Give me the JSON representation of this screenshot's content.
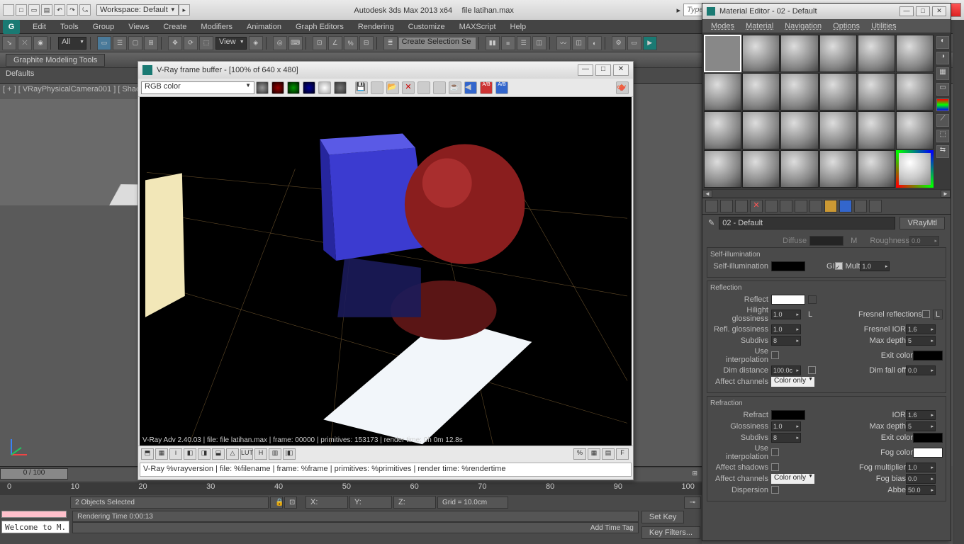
{
  "title": {
    "app": "Autodesk 3ds Max  2013 x64",
    "file": "file latihan.max",
    "workspace": "Workspace: Default",
    "search_ph": "Type a keyword or phrase"
  },
  "menu": [
    "Edit",
    "Tools",
    "Group",
    "Views",
    "Create",
    "Modifiers",
    "Animation",
    "Graph Editors",
    "Rendering",
    "Customize",
    "MAXScript",
    "Help"
  ],
  "toolbar": {
    "all": "All",
    "view": "View",
    "namedsel": "Create Selection Se"
  },
  "graphite": {
    "tab": "Graphite Modeling Tools",
    "defaults": "Defaults"
  },
  "viewport": {
    "label": "[ + ] [ VRayPhysicalCamera001 ] [ Shad"
  },
  "vfb": {
    "title": "V-Ray frame buffer - [100% of 640 x 480]",
    "channel": "RGB color",
    "status1": "V-Ray Adv 2.40.03 | file: file latihan.max | frame: 00000 | primitives: 153173 | render time:  0h  0m 12.8s",
    "btns": [
      "⬒",
      "▦",
      "i",
      "◧",
      "◨",
      "⬓",
      "△",
      "LUT",
      "H",
      "▥",
      "|◧"
    ],
    "status2": "V-Ray %vrayversion | file: %filename | frame: %frame | primitives: %primitives | render time: %rendertime"
  },
  "medit": {
    "title": "Material Editor - 02 - Default",
    "menu": [
      "Modes",
      "Material",
      "Navigation",
      "Options",
      "Utilities"
    ],
    "current": "02 - Default",
    "type": "VRayMtl",
    "scroll_arrows": [
      "◄",
      "►"
    ],
    "groups": {
      "selfillum": {
        "title": "Self-illumination",
        "label": "Self-illumination",
        "gi": "GI",
        "mult": "Mult",
        "multv": "1.0"
      },
      "reflection": {
        "title": "Reflection",
        "labels": {
          "reflect": "Reflect",
          "hilight": "Hilight glossiness",
          "refl": "Refl. glossiness",
          "subdivs": "Subdivs",
          "interp": "Use interpolation",
          "dim": "Dim distance",
          "affect": "Affect channels",
          "fresnel": "Fresnel reflections",
          "ior": "Fresnel IOR",
          "maxd": "Max depth",
          "exit": "Exit color",
          "falloff": "Dim fall off"
        },
        "vals": {
          "hilight": "1.0",
          "refl": "1.0",
          "subdivs": "8",
          "dim": "100.0c",
          "ior": "1.6",
          "maxd": "5",
          "falloff": "0.0",
          "affect": "Color only"
        }
      },
      "refraction": {
        "title": "Refraction",
        "labels": {
          "refract": "Refract",
          "gloss": "Glossiness",
          "subdivs": "Subdivs",
          "interp": "Use interpolation",
          "shadows": "Affect shadows",
          "affect": "Affect channels",
          "ior": "IOR",
          "maxd": "Max depth",
          "exit": "Exit color",
          "fogc": "Fog color",
          "fogm": "Fog multiplier",
          "fogb": "Fog bias",
          "disp": "Dispersion",
          "abbe": "Abbe"
        },
        "vals": {
          "gloss": "1.0",
          "subdivs": "8",
          "ior": "1.6",
          "maxd": "5",
          "fogm": "1.0",
          "fogb": "0.0",
          "abbe": "50.0",
          "affect": "Color only"
        }
      },
      "top": {
        "diffuse": "Diffuse",
        "rough": "Roughness",
        "roughv": "0.0"
      }
    }
  },
  "time": {
    "frame": "0 / 100",
    "ticks": [
      "0",
      "10",
      "20",
      "30",
      "40",
      "50",
      "60",
      "70",
      "80",
      "90",
      "100"
    ],
    "selected": "2 Objects Selected",
    "x": "X:",
    "y": "Y:",
    "z": "Z:",
    "grid": "Grid = 10.0cm",
    "welcome": "Welcome to M.",
    "render": "Rendering Time  0:00:13",
    "addtag": "Add Time Tag",
    "setkey": "Set Key",
    "keyfilters": "Key Filters..."
  }
}
